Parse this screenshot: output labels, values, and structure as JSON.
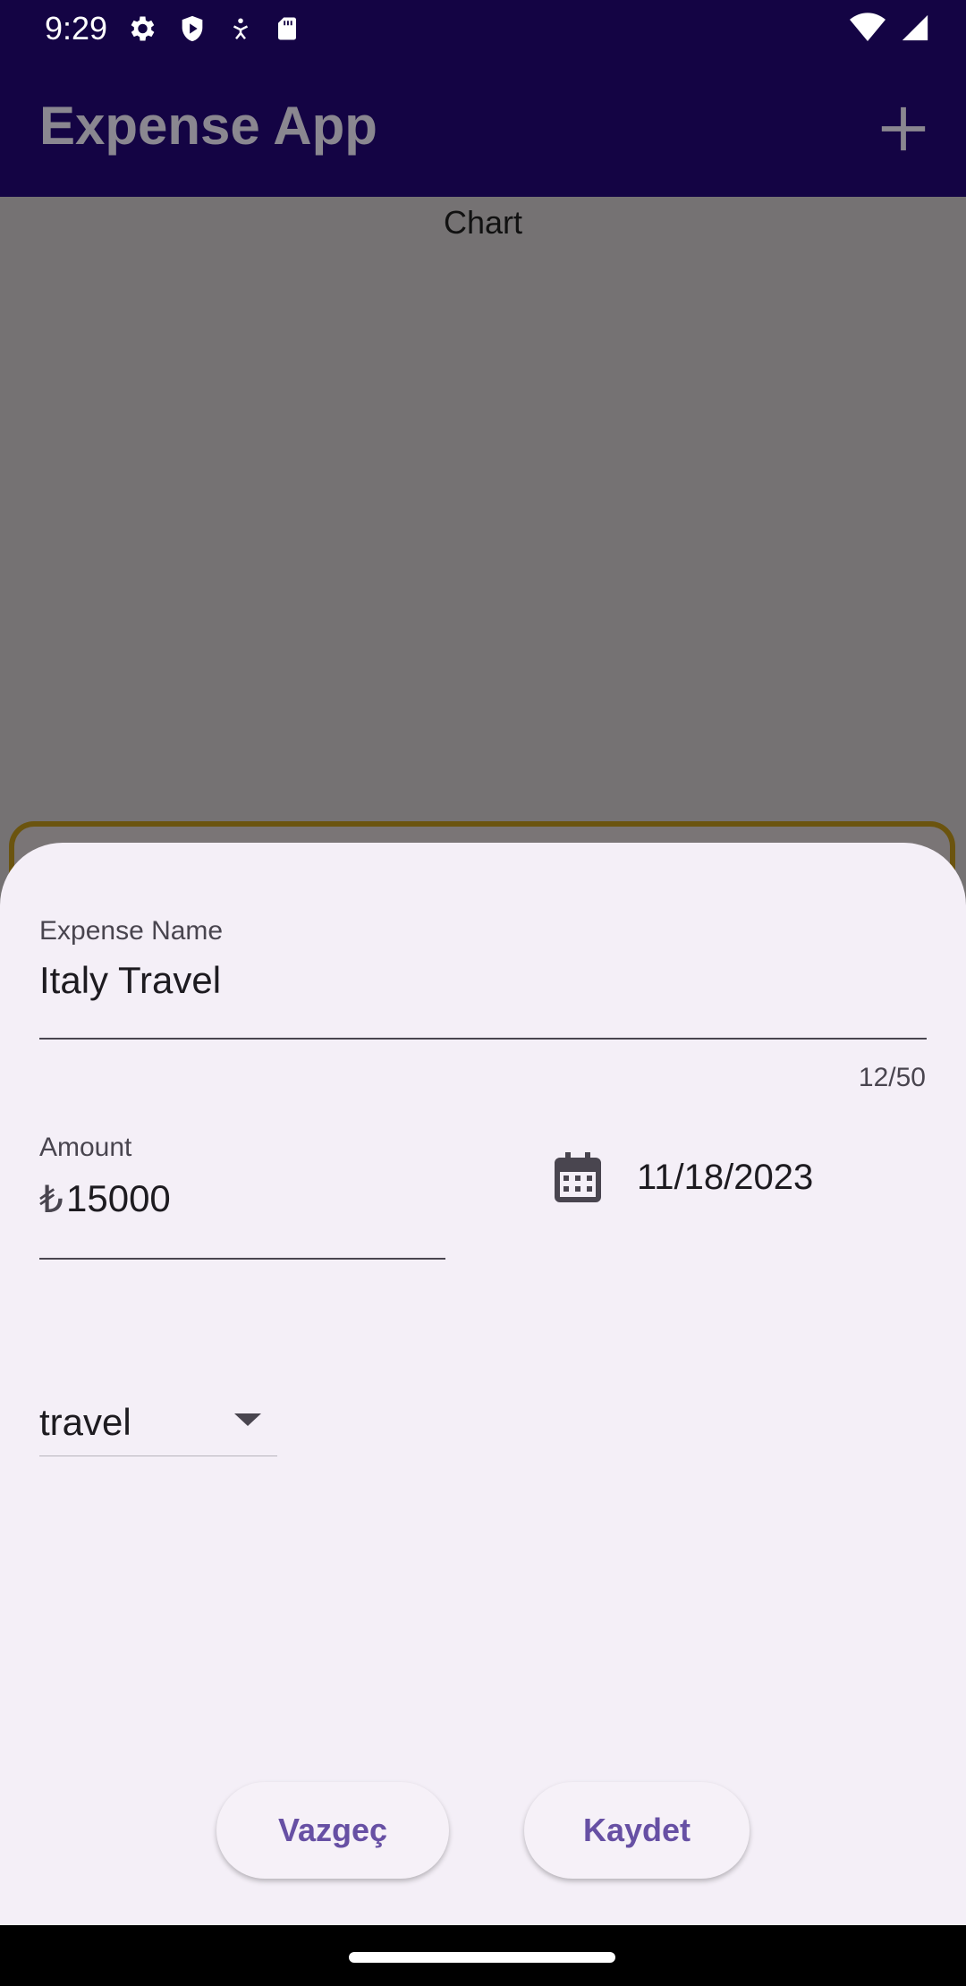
{
  "status_bar": {
    "time": "9:29"
  },
  "app_bar": {
    "title": "Expense App"
  },
  "content": {
    "chart_label": "Chart"
  },
  "sheet": {
    "expense_name": {
      "label": "Expense Name",
      "value": "Italy Travel",
      "counter": "12/50"
    },
    "amount": {
      "label": "Amount",
      "prefix": "₺",
      "value": "15000"
    },
    "date": {
      "value": "11/18/2023"
    },
    "category": {
      "selected": "travel"
    },
    "buttons": {
      "cancel": "Vazgeç",
      "save": "Kaydet"
    }
  },
  "colors": {
    "app_bar": "#140444",
    "sheet_background": "#f4eff7",
    "button_text": "#6750a4",
    "scrim": "#757273"
  },
  "icons": {
    "status": [
      "settings-icon",
      "play-protect-icon",
      "accessibility-icon",
      "sd-card-icon",
      "wifi-icon",
      "signal-icon"
    ],
    "app_bar_action": "add-icon",
    "date_picker": "calendar-icon",
    "dropdown": "arrow-drop-down-icon"
  }
}
